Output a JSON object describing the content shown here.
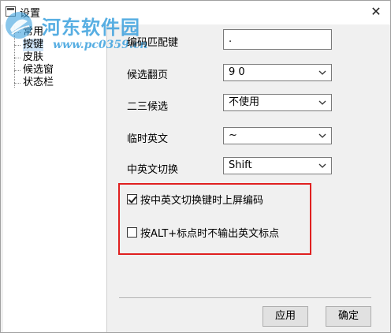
{
  "window": {
    "title": "设置",
    "close_glyph": "✕"
  },
  "watermark": {
    "site_name": "河东软件园",
    "url": "www.pc0359.cn"
  },
  "nav": {
    "items": [
      {
        "label": "常用"
      },
      {
        "label": "按键"
      },
      {
        "label": "皮肤"
      },
      {
        "label": "候选窗"
      },
      {
        "label": "状态栏"
      }
    ]
  },
  "settings": {
    "code_match_key": {
      "label": "编码匹配键",
      "value": "."
    },
    "candidate_page": {
      "label": "候选翻页",
      "value": "9 0"
    },
    "second_third_candidate": {
      "label": "二三候选",
      "value": "不使用"
    },
    "temp_english": {
      "label": "临时英文",
      "value": "~"
    },
    "cn_en_switch": {
      "label": "中英文切换",
      "value": "Shift"
    }
  },
  "options": {
    "commit_code_on_switch": {
      "label": "按中英文切换键时上屏编码",
      "checked": true
    },
    "alt_plus_no_en_punct": {
      "label": "按ALT+标点时不输出英文标点",
      "checked": false
    }
  },
  "buttons": {
    "apply": "应用",
    "ok": "确定"
  },
  "colors": {
    "highlight_border": "#e02020",
    "watermark": "#3aa0de",
    "selected_nav": "#cfe4f7"
  },
  "icons": {
    "dropdown": "chevron-down-icon",
    "close": "close-icon",
    "app": "window-icon"
  }
}
